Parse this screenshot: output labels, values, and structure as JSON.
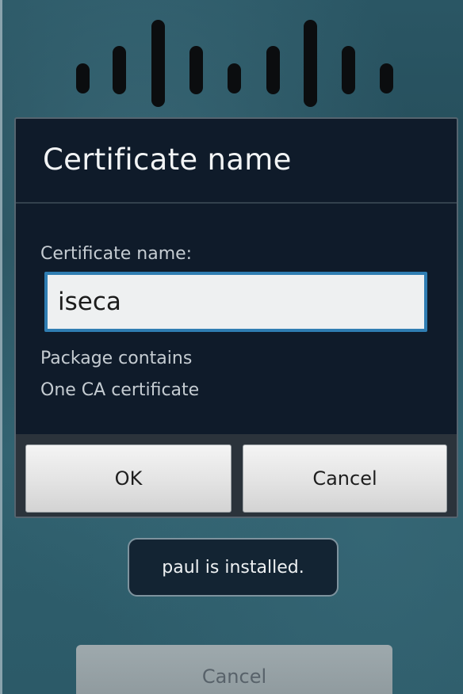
{
  "dialog": {
    "title": "Certificate name",
    "field_label": "Certificate name:",
    "field_value": "iseca",
    "info_line_1": "Package contains",
    "info_line_2": "One CA certificate",
    "ok_label": "OK",
    "cancel_label": "Cancel"
  },
  "toast": {
    "message": "paul is installed."
  },
  "background": {
    "cancel_label": "Cancel",
    "logo": "cisco-bars-logo"
  },
  "colors": {
    "dialog_bg": "#0f1b2a",
    "input_focus_border": "#2f7db2",
    "screen_bg": "#2a5664"
  }
}
